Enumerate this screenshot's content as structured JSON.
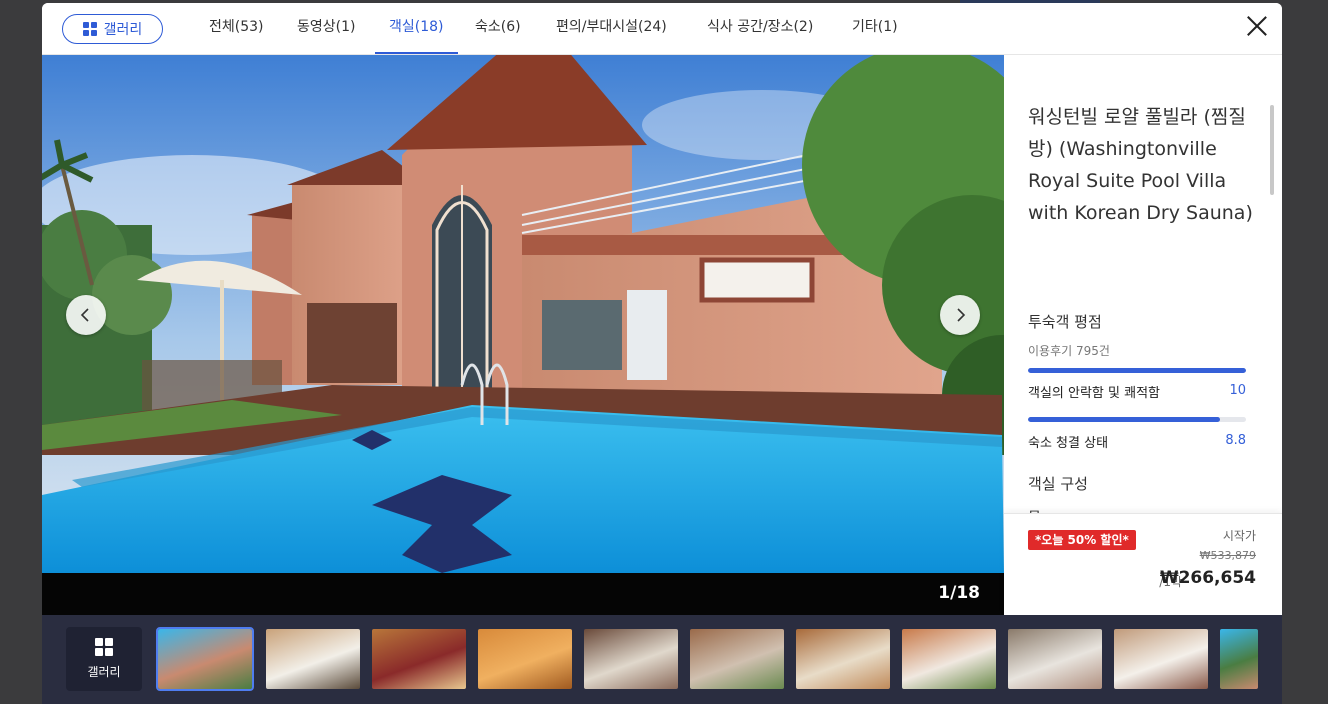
{
  "header": {
    "gallery_label": "갤러리",
    "tabs": [
      {
        "label": "전체(53)",
        "active": false
      },
      {
        "label": "동영상(1)",
        "active": false
      },
      {
        "label": "객실(18)",
        "active": true
      },
      {
        "label": "숙소(6)",
        "active": false
      },
      {
        "label": "편의/부대시설(24)",
        "active": false
      },
      {
        "label": "식사 공간/장소(2)",
        "active": false
      },
      {
        "label": "기타(1)",
        "active": false
      }
    ],
    "close_icon": "close-icon"
  },
  "photo": {
    "counter": "1/18",
    "prev_icon": "chevron-left-icon",
    "next_icon": "chevron-right-icon"
  },
  "panel": {
    "hotel_name": "워싱턴빌 로얄 풀빌라 (찜질방) (Washingtonville Royal Suite Pool Villa with Korean Dry Sauna)",
    "rating_title": "투숙객 평점",
    "review_count": "이용후기 795건",
    "metrics": [
      {
        "label": "객실의 안락함 및 쾌적함",
        "value": "10",
        "score": 10
      },
      {
        "label": "숙소 청결 상태",
        "value": "8.8",
        "score": 8.8
      }
    ],
    "room_title": "객실 구성",
    "room_cut": "무"
  },
  "price": {
    "deal": "*오늘 50% 할인*",
    "start_label": "시작가",
    "original": "₩533,879",
    "per_night": "/1박",
    "final": "₩266,654"
  },
  "strip": {
    "gallery_label": "갤러리",
    "thumbnails": 11,
    "active_index": 0
  },
  "colors": {
    "accent": "#2e5bd6",
    "deal_red": "#e02a2a",
    "strip_bg": "#2a2d40"
  }
}
